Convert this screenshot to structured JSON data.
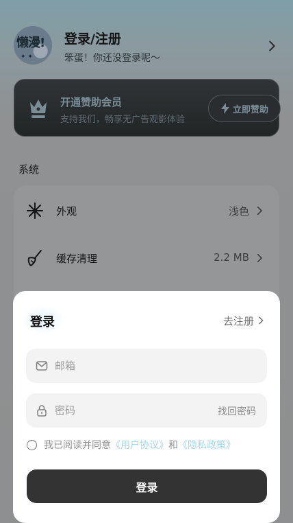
{
  "profile": {
    "avatar_text": "懒漫!",
    "title": "登录/注册",
    "subtitle": "笨蛋！你还没登录呢～"
  },
  "vip": {
    "title": "开通赞助会员",
    "subtitle": "支持我们，畅享无广告观影体验",
    "button_label": "立即赞助"
  },
  "settings": {
    "section_title": "系统",
    "items": [
      {
        "label": "外观",
        "value": "浅色",
        "icon": "sparkle-icon"
      },
      {
        "label": "缓存清理",
        "value": "2.2 MB",
        "icon": "broom-icon"
      }
    ]
  },
  "login_sheet": {
    "title": "登录",
    "register_link": "去注册",
    "email_placeholder": "邮箱",
    "password_placeholder": "密码",
    "forgot_password": "找回密码",
    "agree_prefix": "我已阅读并同意",
    "user_agreement": "《用户协议》",
    "agree_and": "和",
    "privacy_policy": "《隐私政策》",
    "login_button": "登录"
  },
  "colors": {
    "accent_link": "#a5d8ec",
    "primary_button": "#333333",
    "vip_text": "#7b8e98"
  }
}
